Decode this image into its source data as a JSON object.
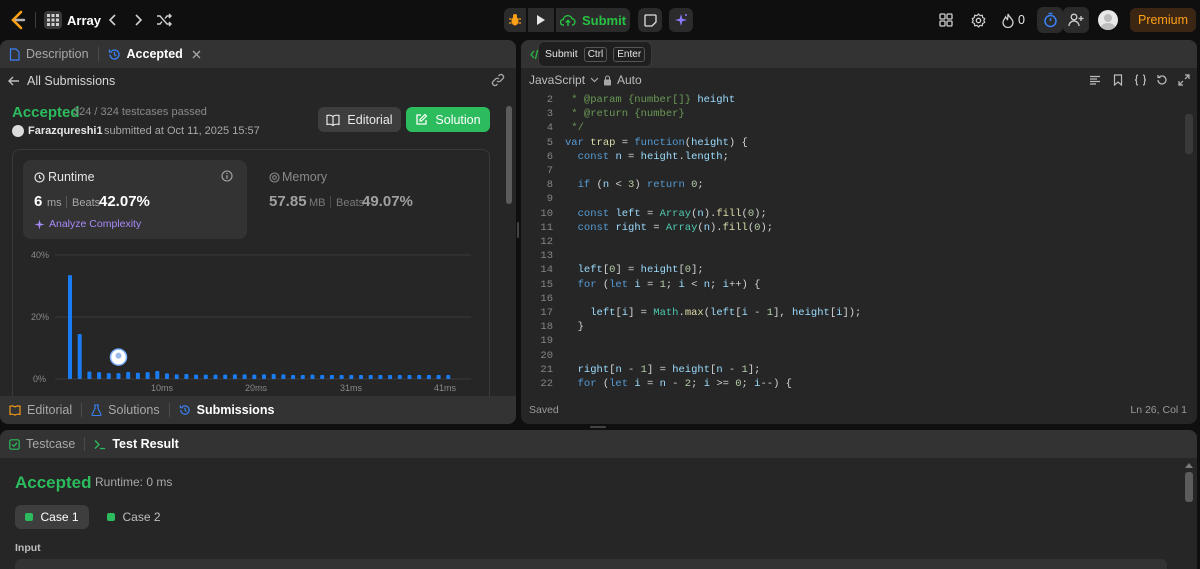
{
  "topbar": {
    "problem_list_label": "Array",
    "submit_label": "Submit",
    "streak_count": "0",
    "premium_label": "Premium"
  },
  "tooltip": {
    "label": "Submit",
    "key1": "Ctrl",
    "key2": "Enter"
  },
  "left_panel": {
    "tabs": [
      "Description",
      "Accepted"
    ],
    "back_label": "All Submissions",
    "status": "Accepted",
    "testcases": "324 / 324 testcases passed",
    "username": "Farazqureshi1",
    "submitted_at": "submitted at Oct 11, 2025 15:57",
    "editorial_label": "Editorial",
    "solution_label": "Solution",
    "runtime": {
      "title": "Runtime",
      "value": "6",
      "unit": "ms",
      "beats_label": "Beats",
      "beats_value": "42.07%",
      "analyze": "Analyze Complexity"
    },
    "memory": {
      "title": "Memory",
      "value": "57.85",
      "unit": "MB",
      "beats_label": "Beats",
      "beats_value": "49.07%"
    },
    "bottom_tabs": [
      "Editorial",
      "Solutions",
      "Submissions"
    ]
  },
  "chart_data": {
    "type": "bar",
    "y_ticks": [
      "40%",
      "20%",
      "0%"
    ],
    "x_ticks": [
      "10ms",
      "20ms",
      "31ms",
      "41ms"
    ],
    "ylim": [
      0,
      40
    ],
    "values": [
      33.5,
      14.5,
      2.4,
      2.2,
      1.9,
      1.9,
      2.3,
      2.0,
      2.2,
      2.6,
      1.8,
      1.5,
      1.6,
      1.4,
      1.4,
      1.4,
      1.4,
      1.5,
      1.5,
      1.4,
      1.5,
      1.6,
      1.5,
      1.3,
      1.3,
      1.4,
      1.3,
      1.3,
      1.3,
      1.3,
      1.3,
      1.3,
      1.3,
      1.3,
      1.3,
      1.3,
      1.3,
      1.3,
      1.3,
      1.3
    ],
    "highlight_index": 5
  },
  "editor": {
    "tab_label": "Code",
    "language": "JavaScript",
    "mode": "Auto",
    "saved": "Saved",
    "cursor": "Ln 26, Col 1",
    "line_numbers": [
      "2",
      "3",
      "4",
      "5",
      "6",
      "7",
      "8",
      "9",
      "10",
      "11",
      "12",
      "13",
      "14",
      "15",
      "16",
      "17",
      "18",
      "19",
      "20",
      "21",
      "22"
    ]
  },
  "bottom_panel": {
    "tabs": [
      "Testcase",
      "Test Result"
    ],
    "status": "Accepted",
    "runtime": "Runtime: 0 ms",
    "cases": [
      "Case 1",
      "Case 2"
    ],
    "input_label": "Input"
  }
}
